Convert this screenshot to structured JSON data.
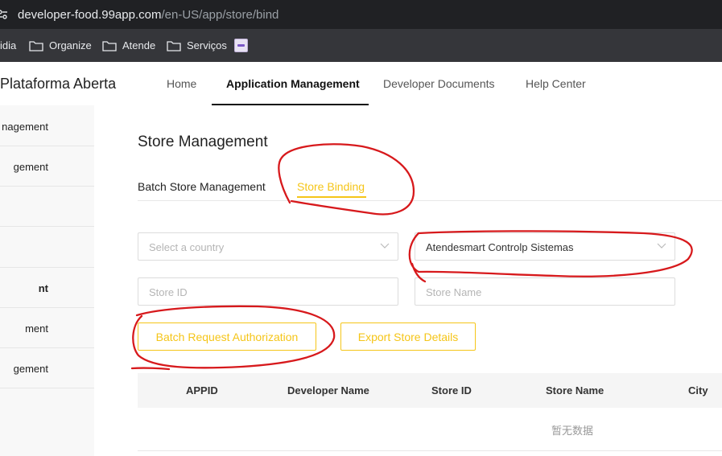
{
  "browser": {
    "url_host": "developer-food.99app.com",
    "url_path": "/en-US/app/store/bind",
    "bookmarks": [
      "idia",
      "Organize",
      "Atende",
      "Serviços"
    ]
  },
  "header": {
    "brand": "Plataforma Aberta",
    "nav": [
      "Home",
      "Application Management",
      "Developer Documents",
      "Help Center"
    ]
  },
  "sidebar": {
    "items": [
      "nagement",
      "gement",
      "",
      "",
      "nt",
      "ment",
      "gement"
    ]
  },
  "main": {
    "title": "Store Management",
    "tabs": [
      "Batch Store Management",
      "Store Binding"
    ],
    "filters": {
      "country_placeholder": "Select a country",
      "developer_value": "Atendesmart Controlp Sistemas",
      "store_id_placeholder": "Store ID",
      "store_name_placeholder": "Store Name"
    },
    "buttons": {
      "batch_request": "Batch Request Authorization",
      "export": "Export Store Details"
    },
    "table": {
      "columns": [
        "APPID",
        "Developer Name",
        "Store ID",
        "Store Name",
        "City"
      ],
      "empty_text": "暂无数据"
    }
  },
  "colors": {
    "accent": "#f5c518",
    "annotation": "#d7191c"
  }
}
